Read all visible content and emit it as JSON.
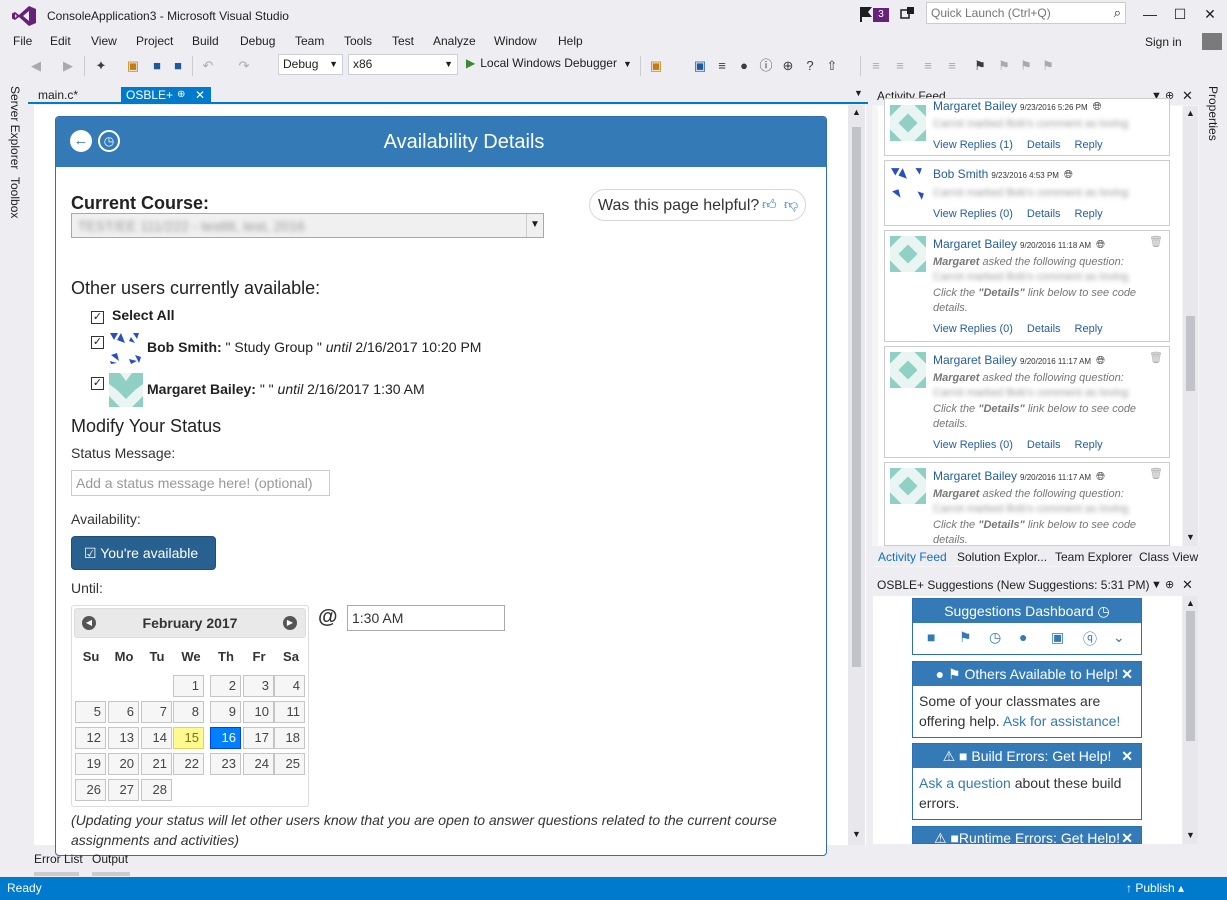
{
  "window": {
    "title": "ConsoleApplication3 - Microsoft Visual Studio",
    "notification_count": "3",
    "quick_launch_placeholder": "Quick Launch (Ctrl+Q)",
    "sign_in": "Sign in"
  },
  "menu": [
    "File",
    "Edit",
    "View",
    "Project",
    "Build",
    "Debug",
    "Team",
    "Tools",
    "Test",
    "Analyze",
    "Window",
    "Help"
  ],
  "toolbar": {
    "configuration": "Debug",
    "platform": "x86",
    "run_label": "Local Windows Debugger"
  },
  "left_tabs": [
    "Server Explorer",
    "Toolbox"
  ],
  "doc_tabs": {
    "main": "main.c*",
    "osble": "OSBLE+"
  },
  "availability": {
    "title": "Availability Details",
    "current_course_label": "Current Course:",
    "current_course_value": "TEST/EE 111/222 - testttt, test, 2016",
    "helpful_prompt": "Was this page helpful?",
    "others_heading": "Other users currently available:",
    "select_all": "Select All",
    "users": [
      {
        "name": "Bob Smith:",
        "status": " \" Study Group \" ",
        "until_word": "until",
        "until_value": " 2/16/2017 10:20 PM",
        "checked": true
      },
      {
        "name": "Margaret Bailey:",
        "status": " \" \" ",
        "until_word": "until",
        "until_value": " 2/16/2017 1:30 AM",
        "checked": true
      }
    ],
    "modify_heading": "Modify Your Status",
    "status_message_label": "Status Message:",
    "status_placeholder": "Add a status message here! (optional)",
    "availability_label": "Availability:",
    "available_button": "You're available",
    "until_label": "Until:",
    "at_sign": "@",
    "time_value": "1:30 AM",
    "note": "(Updating your status will let other users know that you are open to answer questions related to the current course assignments and activities)"
  },
  "calendar": {
    "month": "February 2017",
    "days_of_week": [
      "Su",
      "Mo",
      "Tu",
      "We",
      "Th",
      "Fr",
      "Sa"
    ],
    "weeks": [
      [
        "",
        "",
        "",
        "1",
        "2",
        "3",
        "4"
      ],
      [
        "5",
        "6",
        "7",
        "8",
        "9",
        "10",
        "11"
      ],
      [
        "12",
        "13",
        "14",
        "15",
        "16",
        "17",
        "18"
      ],
      [
        "19",
        "20",
        "21",
        "22",
        "23",
        "24",
        "25"
      ],
      [
        "26",
        "27",
        "28",
        "",
        "",
        "",
        ""
      ]
    ],
    "today": "15",
    "selected": "16"
  },
  "activity_feed": {
    "title": "Activity Feed",
    "posts": [
      {
        "author": "Margaret Bailey",
        "date": "9/23/2016 5:26 PM",
        "lines": [
          "Carrot marked Bob's comment as loving"
        ],
        "links": [
          "View Replies (1)",
          "Details",
          "Reply"
        ]
      },
      {
        "author": "Bob Smith",
        "date": "9/23/2016 4:53 PM",
        "lines": [
          "Carrot marked Bob's comment as loving"
        ],
        "links": [
          "View Replies (0)",
          "Details",
          "Reply"
        ]
      },
      {
        "author": "Margaret Bailey",
        "date": "9/20/2016 11:18 AM",
        "asked_name": "Margaret",
        "asked_text": " asked the following question:",
        "hidden_line": "Carrot marked Bob's comment as loving",
        "hint_pre": "Click the ",
        "hint_bold": "\"Details\"",
        "hint_post": " link below to see code details.",
        "links": [
          "View Replies (0)",
          "Details",
          "Reply"
        ]
      },
      {
        "author": "Margaret Bailey",
        "date": "9/20/2016 11:17 AM",
        "asked_name": "Margaret",
        "asked_text": " asked the following question:",
        "hidden_line": "Carrot marked Bob's comment as loving",
        "hint_pre": "Click the ",
        "hint_bold": "\"Details\"",
        "hint_post": " link below to see code details.",
        "links": [
          "View Replies (0)",
          "Details",
          "Reply"
        ]
      },
      {
        "author": "Margaret Bailey",
        "date": "9/20/2016 11:17 AM",
        "asked_name": "Margaret",
        "asked_text": " asked the following question:",
        "hidden_line": "Carrot marked Bob's comment as loving",
        "hint_pre": "Click the ",
        "hint_bold": "\"Details\"",
        "hint_post": " link below to see code details."
      }
    ],
    "bottom_tabs": [
      "Activity Feed",
      "Solution Explor...",
      "Team Explorer",
      "Class View"
    ]
  },
  "suggestions": {
    "title": "OSBLE+ Suggestions (New Suggestions: 5:31 PM)",
    "dashboard_title": "Suggestions Dashboard",
    "cards": [
      {
        "title": "Others Available to Help!",
        "body_pre": "Some of your classmates are offering help. ",
        "body_link": "Ask for assistance!",
        "body_post": ""
      },
      {
        "title": "Build Errors: Get Help!",
        "body_pre": "",
        "body_link": "Ask a question",
        "body_post": " about these build errors."
      },
      {
        "title": "Runtime Errors: Get Help!"
      }
    ]
  },
  "right_tab": "Properties",
  "bottom_tool_tabs": [
    "Error List",
    "Output"
  ],
  "status_bar": {
    "left": "Ready",
    "right": "Publish"
  },
  "colors": {
    "accent": "#007acc",
    "osble_blue": "#337ab7",
    "vs_purple": "#68217a"
  }
}
